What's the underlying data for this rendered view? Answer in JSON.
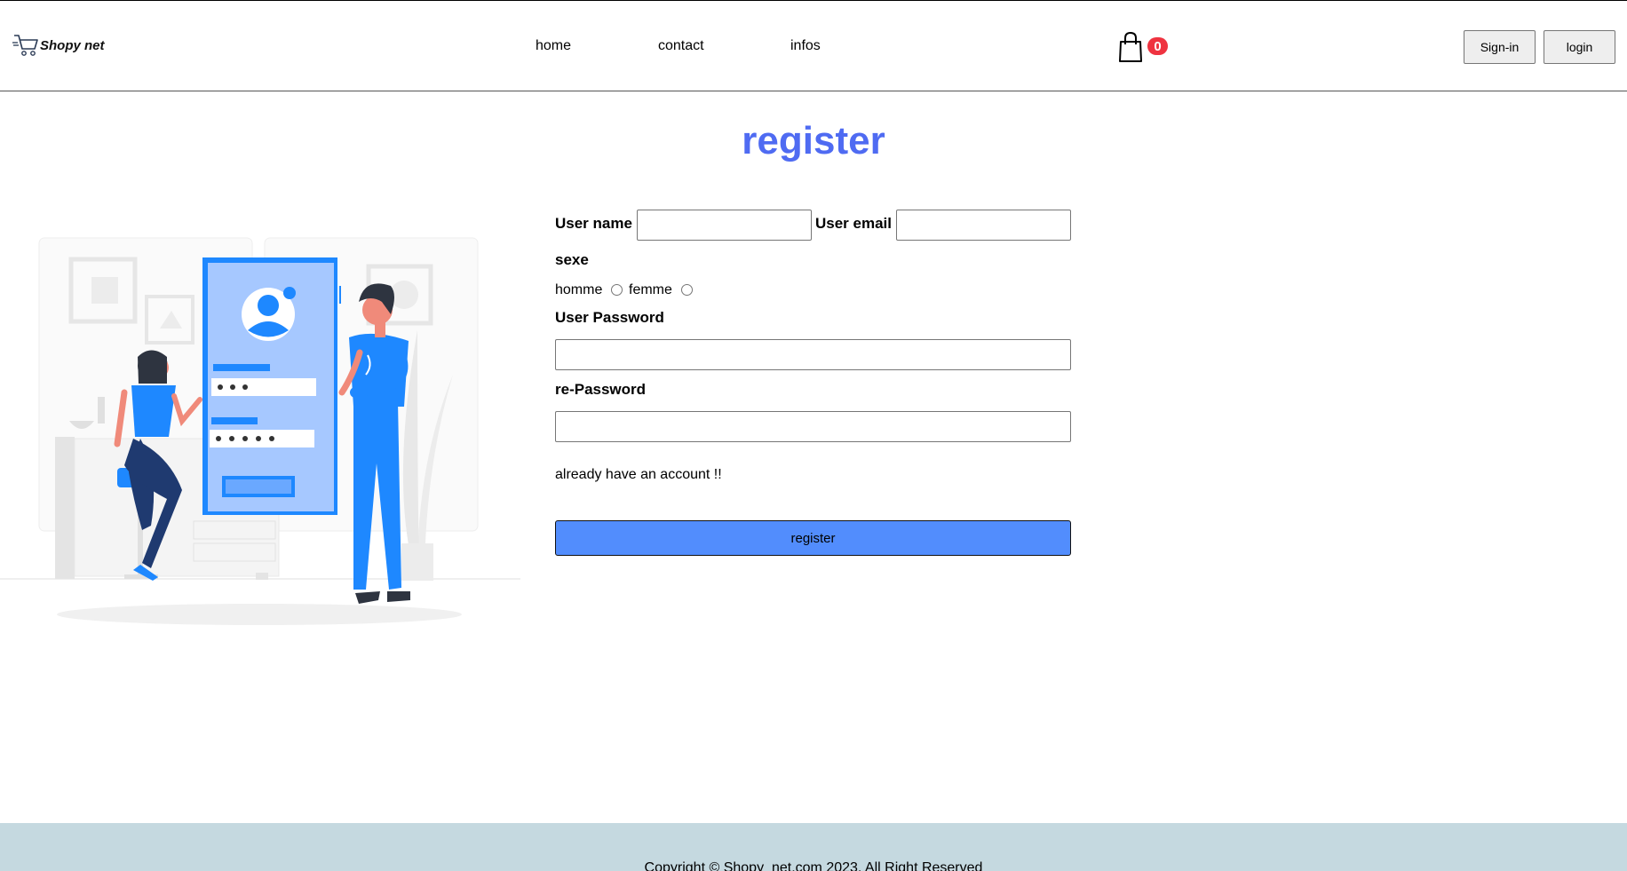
{
  "header": {
    "logo_text": "Shopy net",
    "nav": [
      "home",
      "contact",
      "infos"
    ],
    "cart_count": "0",
    "signin_label": "Sign-in",
    "login_label": "login"
  },
  "page": {
    "title": "register"
  },
  "form": {
    "username_label": "User name",
    "username_value": "",
    "email_label": "User email",
    "email_value": "",
    "sex_label": "sexe",
    "sex_options": [
      "homme",
      "femme"
    ],
    "sex_selected": "",
    "password_label": "User Password",
    "password_value": "",
    "repassword_label": "re-Password",
    "repassword_value": "",
    "account_link": "already have an account !!",
    "submit_label": "register"
  },
  "footer": {
    "copyright": "Copyright © Shopy_net.com 2023. All Right Reserved"
  },
  "colors": {
    "title": "#4f6bf2",
    "submit_bg": "#528dfd",
    "badge": "#ef3340",
    "footer_bg": "#c5d9e0",
    "illustration_blue": "#1e88ff"
  },
  "icons": {
    "logo": "shopping-cart-icon",
    "cart": "shopping-bag-icon"
  }
}
